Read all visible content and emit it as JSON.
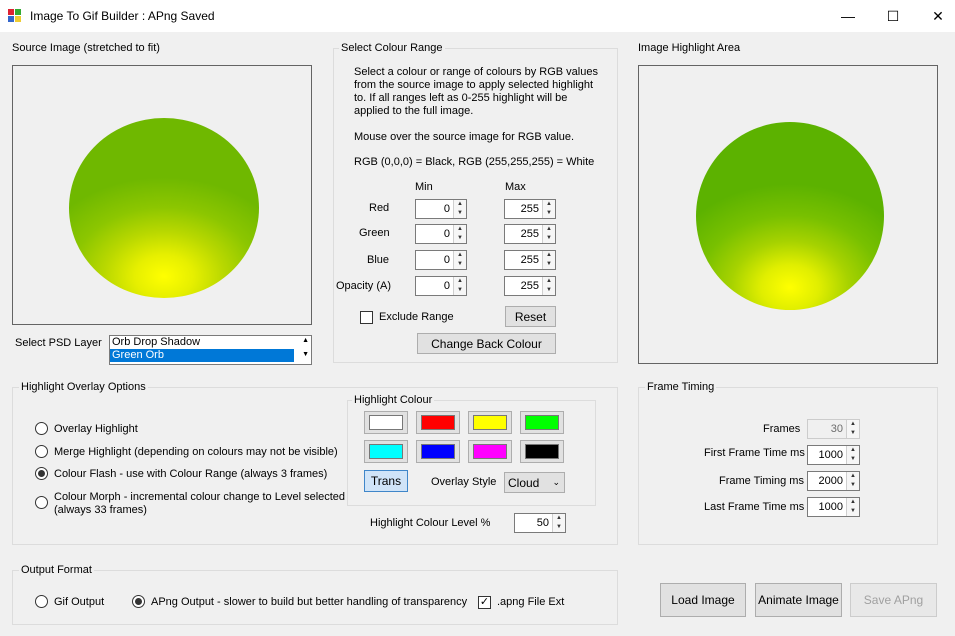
{
  "window": {
    "title": "Image To Gif Builder : APng Saved",
    "minimize": "—",
    "maximize": "☐",
    "close": "✕"
  },
  "source": {
    "label": "Source Image (stretched to fit)",
    "psd_label": "Select PSD Layer",
    "layers": [
      "Orb Drop Shadow",
      "Green Orb"
    ],
    "selected_layer": "Green Orb"
  },
  "colour_range": {
    "title": "Select Colour Range",
    "description": "Select a colour or range of colours by RGB values from the source image to apply selected highlight to. If all ranges left as 0-255 highlight will be applied to the full image.",
    "hint": "Mouse over the source image for RGB value.",
    "rgb_note": "RGB (0,0,0) = Black, RGB (255,255,255) = White",
    "min_header": "Min",
    "max_header": "Max",
    "rows": [
      {
        "label": "Red",
        "min": "0",
        "max": "255"
      },
      {
        "label": "Green",
        "min": "0",
        "max": "255"
      },
      {
        "label": "Blue",
        "min": "0",
        "max": "255"
      },
      {
        "label": "Opacity (A)",
        "min": "0",
        "max": "255"
      }
    ],
    "exclude_label": "Exclude Range",
    "exclude_checked": false,
    "reset_label": "Reset",
    "change_back_label": "Change Back Colour"
  },
  "highlight_area": {
    "label": "Image Highlight Area"
  },
  "overlay_options": {
    "title": "Highlight Overlay Options",
    "options": [
      {
        "label": "Overlay Highlight",
        "checked": false
      },
      {
        "label": "Merge Highlight (depending on colours may not be visible)",
        "checked": false
      },
      {
        "label": "Colour Flash - use with Colour Range (always 3 frames)",
        "checked": true
      },
      {
        "label": "Colour Morph - incremental colour change to Level selected",
        "label2": "(always 33 frames)",
        "checked": false
      }
    ],
    "highlight_colour_title": "Highlight Colour",
    "swatches": [
      "#ffffff",
      "#ff0000",
      "#ffff00",
      "#00ff00",
      "#00ffff",
      "#0000ff",
      "#ff00ff",
      "#000000"
    ],
    "trans_label": "Trans",
    "overlay_style_label": "Overlay Style",
    "overlay_style_value": "Cloud",
    "level_label": "Highlight Colour Level %",
    "level_value": "50"
  },
  "frame_timing": {
    "title": "Frame Timing",
    "rows": [
      {
        "label": "Frames",
        "value": "30",
        "disabled": true
      },
      {
        "label": "First Frame Time ms",
        "value": "1000",
        "disabled": false
      },
      {
        "label": "Frame Timing ms",
        "value": "2000",
        "disabled": false
      },
      {
        "label": "Last Frame Time ms",
        "value": "1000",
        "disabled": false
      }
    ]
  },
  "output_format": {
    "title": "Output Format",
    "gif_label": "Gif Output",
    "gif_checked": false,
    "apng_label": "APng Output - slower to build but better handling of transparency",
    "apng_checked": true,
    "ext_label": ".apng File Ext",
    "ext_checked": true
  },
  "actions": {
    "load_label": "Load Image",
    "animate_label": "Animate Image",
    "save_label": "Save APng"
  },
  "colors": {
    "selection": "#0078d7",
    "trans_button_bg": "#d0e4f8",
    "trans_button_border": "#3f86c9"
  }
}
